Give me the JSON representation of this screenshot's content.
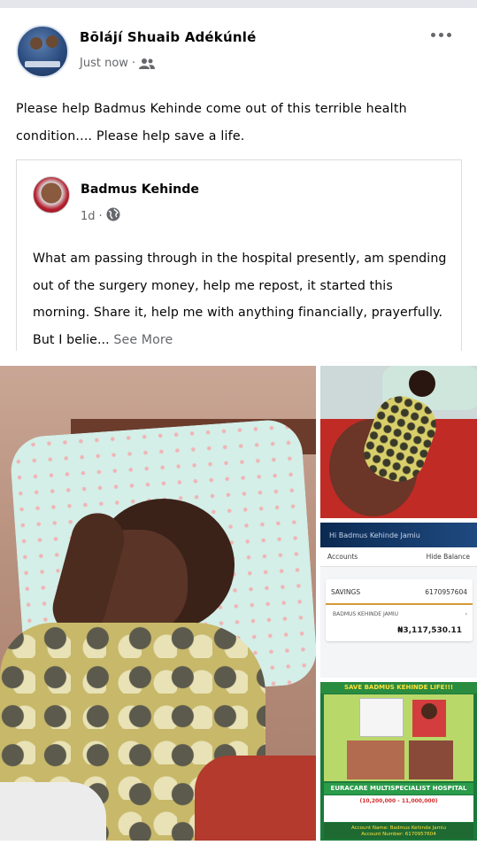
{
  "post": {
    "author_name": "Bōlájí Shuaib Adékúnlé",
    "timestamp": "Just now",
    "audience_icon": "friends-icon",
    "text": "Please help Badmus Kehinde come out of this terrible health condition.... Please help save a life."
  },
  "shared_post": {
    "author_name": "Badmus Kehinde",
    "timestamp": "1d",
    "audience_icon": "globe-icon",
    "text": "What am passing through in the hospital presently, am spending out of the surgery money, help me repost, it started this morning. Share it, help me with anything financially, prayerfully. But I belie...",
    "see_more": "See More"
  },
  "bank_screenshot": {
    "greeting": "Hi Badmus Kehinde Jamiu",
    "accounts_label": "Accounts",
    "hide_balance": "Hide Balance",
    "account_type": "SAVINGS",
    "account_number": "6170957604",
    "holder": "BADMUS KEHINDE JAMIU",
    "balance": "₦3,117,530.11",
    "chevron": "›"
  },
  "flyer": {
    "title": "SAVE BADMUS KEHINDE LIFE!!!",
    "hospital": "EURACARE MULTISPECIALIST HOSPITAL",
    "amount": "(10,200,000 - 11,000,000)",
    "account_name": "Account Name: Badmus Kehinde Jamiu",
    "account_number": "Account Number: 6170957604"
  },
  "colors": {
    "text_primary": "#050505",
    "text_secondary": "#65676b",
    "border": "#dadde1"
  }
}
